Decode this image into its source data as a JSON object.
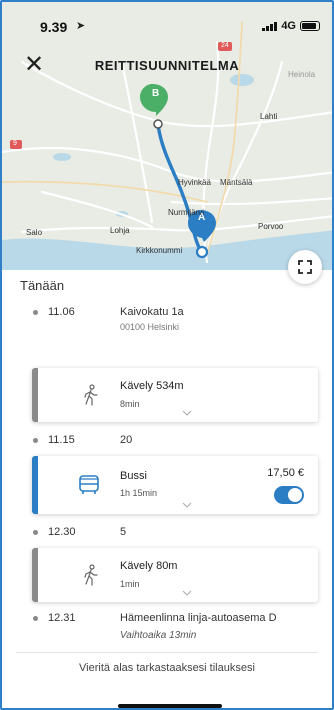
{
  "status_bar": {
    "time": "9.39",
    "network": "4G"
  },
  "header": {
    "title": "REITTISUUNNITELMA",
    "close_icon": "close-icon"
  },
  "map": {
    "labels": [
      "Lahti",
      "Hyvinkää",
      "Mäntsälä",
      "Nurmijärvi",
      "Porvoo",
      "Salo",
      "Lohja",
      "Kirkkonummi",
      "Heinola"
    ],
    "road_badge": "24",
    "road_badge_2": "9",
    "marker_start": "A",
    "marker_end": "B",
    "route_color": "#2b7dc4",
    "marker_a_color": "#2b7dc4",
    "marker_b_color": "#4caf68"
  },
  "itinerary": {
    "day_label": "Tänään",
    "stops": [
      {
        "time": "11.06",
        "name": "Kaivokatu 1a",
        "sub": "00100 Helsinki"
      },
      {
        "time": "11.15",
        "name": "20",
        "sub": ""
      },
      {
        "time": "12.30",
        "name": "5",
        "sub": ""
      },
      {
        "time": "12.31",
        "name": "Hämeenlinna linja-autoasema D",
        "sub": "Vaihtoaika 13min"
      }
    ],
    "legs": [
      {
        "mode": "Kävely 534m",
        "duration": "8min",
        "icon": "walking-icon"
      },
      {
        "mode": "Bussi",
        "duration": "1h 15min",
        "icon": "bus-icon",
        "price": "17,50 €",
        "selected": true
      },
      {
        "mode": "Kävely 80m",
        "duration": "1min",
        "icon": "walking-icon"
      }
    ]
  },
  "footer": {
    "hint": "Vieritä alas tarkastaaksesi tilauksesi"
  }
}
